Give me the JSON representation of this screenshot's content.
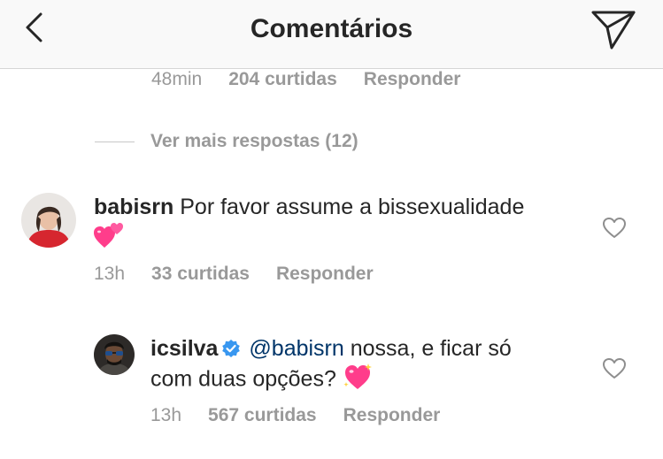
{
  "header": {
    "title": "Comentários"
  },
  "top_meta": {
    "time": "48min",
    "likes": "204 curtidas",
    "reply": "Responder"
  },
  "more_replies": {
    "label": "Ver mais respostas (12)"
  },
  "comment1": {
    "username": "babisrn",
    "text": "Por favor assume a bissexualidade",
    "emoji": "two-hearts-icon",
    "time": "13h",
    "likes": "33 curtidas",
    "reply": "Responder"
  },
  "comment2": {
    "username": "icsilva",
    "verified": true,
    "mention": "@babisrn",
    "text_line1": " nossa, e ficar só",
    "text_line2": "com duas opções? ",
    "emoji": "sparkling-heart-icon",
    "time": "13h",
    "likes": "567 curtidas",
    "reply": "Responder"
  },
  "colors": {
    "accent_blue": "#3897f0",
    "mention": "#003569",
    "meta_gray": "#999999",
    "text": "#262626",
    "emoji_pink": "#ff3d8b"
  }
}
